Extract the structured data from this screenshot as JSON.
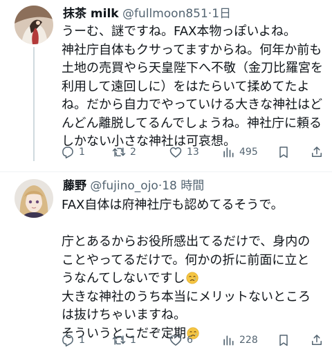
{
  "tweets": [
    {
      "display_name": "抹茶 milk",
      "handle": "@fullmoon851",
      "separator": "·",
      "time": "1日",
      "body_lines": [
        "うーむ、謎ですね。FAX本物っぽいよね。",
        "神社庁自体もクサってますからね。何年か前も",
        "土地の売買やら天皇陛下へ不敬（金刀比羅宮を",
        "利用して遠回しに）をはたらいて揉めてたよ",
        "ね。だから自力でやっていける大きな神社はど",
        "んどん離脱してるんでしょうね。神社庁に頼る",
        "しかない小さな神社は可哀想。"
      ],
      "counts": {
        "replies": "1",
        "retweets": "2",
        "likes": "13",
        "views": "495"
      }
    },
    {
      "display_name": "藤野",
      "handle": "@fujino_ojo",
      "separator": "·",
      "time": "18 時間",
      "body_lines": [
        "FAX自体は府神社庁も認めてるそうで。",
        "",
        "庁とあるからお役所感出てるだけで、身内の",
        "ことやってるだけで。何かの折に前面に立と",
        "うなんてしないですし",
        "大きな神社のうち本当にメリットないところ",
        "は抜けちゃいますね。",
        "そういうとこだぞ定期"
      ],
      "counts": {
        "replies": "1",
        "retweets": "1",
        "likes": "6",
        "views": "228"
      }
    }
  ],
  "icons": {
    "reply": "reply-icon",
    "retweet": "retweet-icon",
    "like": "heart-icon",
    "views": "views-icon",
    "bookmark": "bookmark-icon",
    "share": "share-icon",
    "emoji": "sad-but-relieved-face-emoji"
  },
  "colors": {
    "text_primary": "#0f1419",
    "text_secondary": "#536471",
    "thread_line": "#cfd9de",
    "divider": "#eff3f4"
  }
}
